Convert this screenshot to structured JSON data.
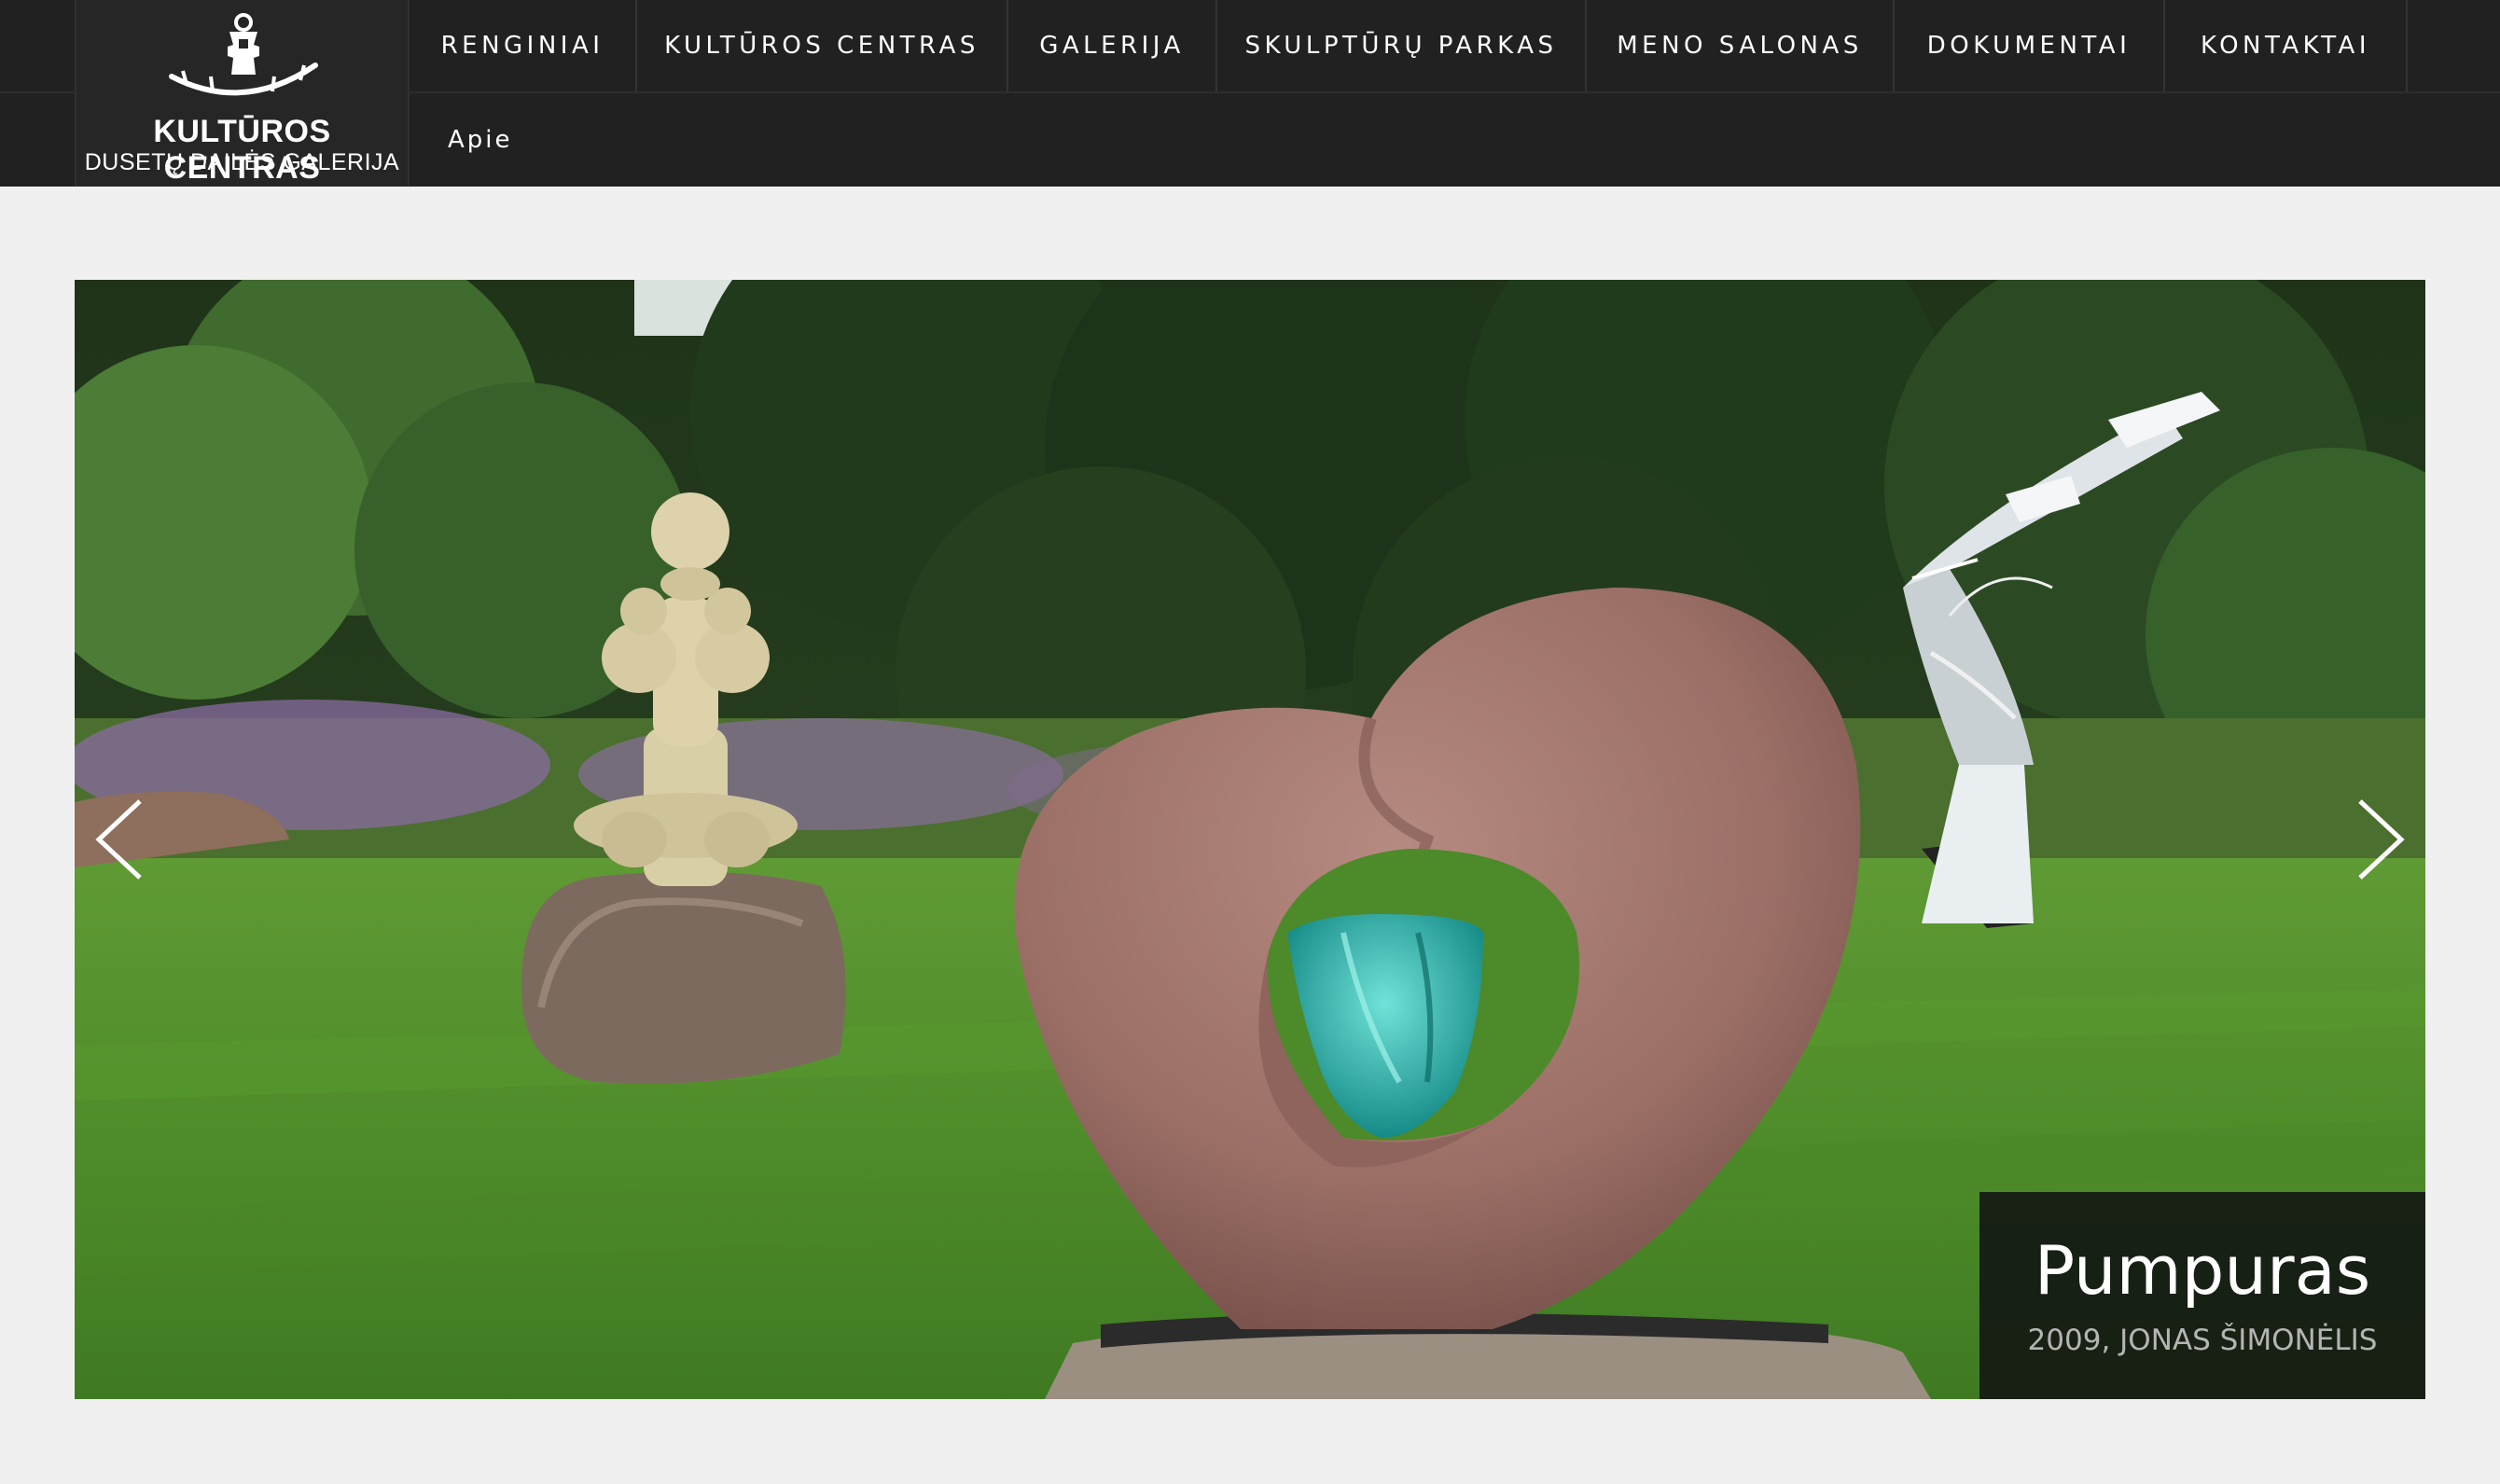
{
  "brand": {
    "title": "KULTŪROS CENTRAS",
    "subtitle": "DUSETŲ DAILĖS GALERIJA",
    "logo_icon": "boat-figure-logo-icon"
  },
  "nav": {
    "items": [
      {
        "label": "RENGINIAI",
        "name": "nav-item-renginiai"
      },
      {
        "label": "KULTŪROS CENTRAS",
        "name": "nav-item-kulturos-centras"
      },
      {
        "label": "GALERIJA",
        "name": "nav-item-galerija"
      },
      {
        "label": "SKULPTŪRŲ PARKAS",
        "name": "nav-item-skulpturu-parkas"
      },
      {
        "label": "MENO SALONAS",
        "name": "nav-item-meno-salonas"
      },
      {
        "label": "DOKUMENTAI",
        "name": "nav-item-dokumentai"
      },
      {
        "label": "KONTAKTAI",
        "name": "nav-item-kontaktai"
      }
    ],
    "sub_item": "Apie"
  },
  "slider": {
    "prev_icon": "chevron-left-icon",
    "next_icon": "chevron-right-icon",
    "caption": {
      "title": "Pumpuras",
      "subtitle": "2009, JONAS ŠIMONĖLIS"
    }
  },
  "colors": {
    "header_bg": "#212121",
    "page_bg": "#f0f0f0",
    "caption_bg": "#141812"
  }
}
